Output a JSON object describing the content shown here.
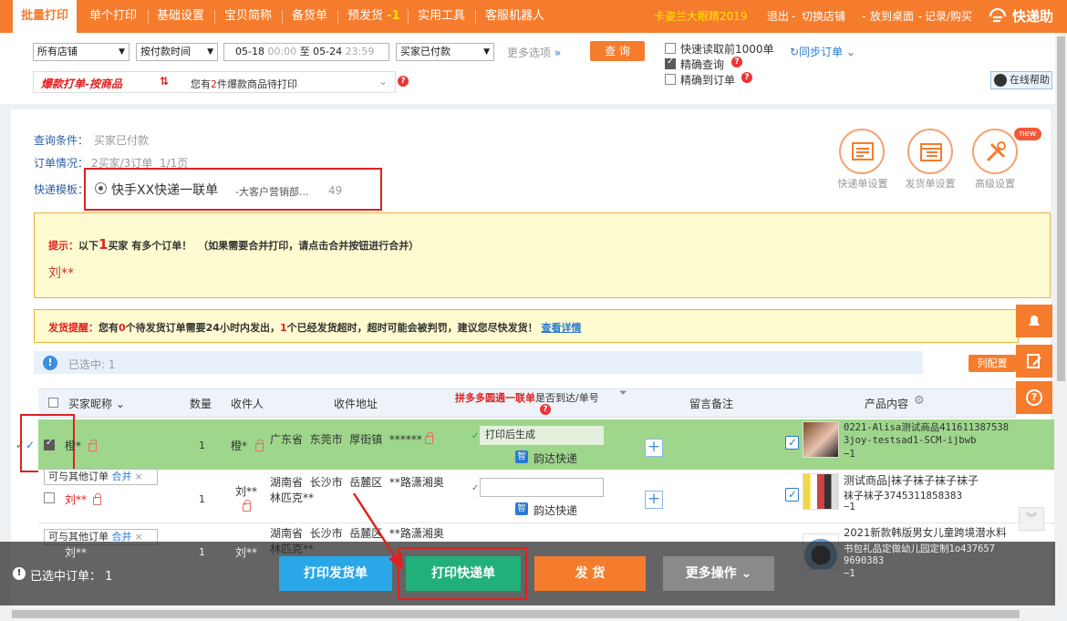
{
  "nav": {
    "tabs": [
      "批量打印",
      "单个打印",
      "基础设置",
      "宝贝简称",
      "备货单",
      "预发货",
      "实用工具",
      "客服机器人"
    ],
    "presale_badge": "-1",
    "shop": "卡姿兰大眼睛2019",
    "exit": "退出",
    "switch_shop": "切换店铺",
    "desktop": "放到桌面",
    "record": "记录/购买",
    "brand": "快递助"
  },
  "filters": {
    "shop": "所有店铺",
    "time_type": "按付款时间",
    "date_from": "05-18",
    "time_from": "00:00",
    "date_sep": "至",
    "date_to": "05-24",
    "time_to": "23:59",
    "status": "买家已付款",
    "more": "更多选项",
    "query": "查 询",
    "quick_read": "快速读取前1000单",
    "precise_query": "精确查询",
    "precise_order": "精确到订单",
    "sync": "同步订单",
    "online_help": "在线帮助"
  },
  "hot": {
    "title": "爆款打单-按商品",
    "prefix": "您有",
    "count": "2",
    "suffix": "件爆款商品待打印"
  },
  "info": {
    "cond_label": "查询条件：",
    "cond_value": "买家已付款",
    "order_label": "订单情况：",
    "order_value": "2买家/3订单  1/1页",
    "tpl_label": "快递模板：",
    "tpl_name": "快手XX快递一联单",
    "tpl_sub": "-大客户营销部...",
    "tpl_count": "49"
  },
  "icons": {
    "express_settings": "快递单设置",
    "ship_settings": "发货单设置",
    "advanced": "高级设置",
    "new_badge": "new"
  },
  "tip": {
    "label": "提示：",
    "pre": "以下",
    "num": "1",
    "post": "买家 有多个订单！",
    "note": "（如果需要合并打印，请点击合并按钮进行合并）",
    "name": "刘**"
  },
  "remind": {
    "label": "发货提醒：",
    "p1": "您有",
    "n1": "0",
    "p2": "个待发货订单需要24小时内发出，",
    "n2": "1",
    "p3": "个已经发货超时，超时可能会被判罚，建议您尽快发货！",
    "link": "查看详情"
  },
  "selected": {
    "label": "已选中:",
    "count": "1",
    "col_config": "列配置"
  },
  "table": {
    "headers": [
      "买家昵称",
      "数量",
      "收件人",
      "收件地址",
      "拼多多圆通一联单",
      "是否到达/单号",
      "留言备注",
      "产品内容"
    ]
  },
  "rows": [
    {
      "buyer": "橙*",
      "qty": "1",
      "recipient": "橙*",
      "address": "广东省  东莞市  厚街镇  ******",
      "waybill": "打印后生成",
      "carrier": "韵达快递",
      "product1": "0221-Alisa测试商品411611387538",
      "product2": "3joy-testsad1-SCM-ijbwb",
      "product3": "−1"
    },
    {
      "merge_note": "可与其他订单",
      "merge_link": "合并",
      "buyer": "刘**",
      "qty": "1",
      "recipient": "刘**",
      "address": "湖南省  长沙市  岳麓区  **路潇湘奥林匹克**",
      "carrier": "韵达快递",
      "product1": "测试商品|袜子袜子袜子袜子",
      "product2": "袜子袜子3745311858383",
      "product3": "−1"
    },
    {
      "merge_note": "可与其他订单",
      "merge_link": "合并",
      "buyer": "刘**",
      "qty": "1",
      "recipient": "刘**",
      "address": "湖南省  长沙市  岳麓区  **路潇湘奥林匹克**",
      "product1": "2021新款韩版男女儿童跨境潜水料",
      "product2": "书包礼品定做幼儿园定制1o437657",
      "product3": "9690383",
      "product4": "−1"
    }
  ],
  "footer": {
    "selected_label": "已选中订单：",
    "selected_count": "1",
    "print_ship": "打印发货单",
    "print_express": "打印快递单",
    "deliver": "发 货",
    "more": "更多操作"
  }
}
